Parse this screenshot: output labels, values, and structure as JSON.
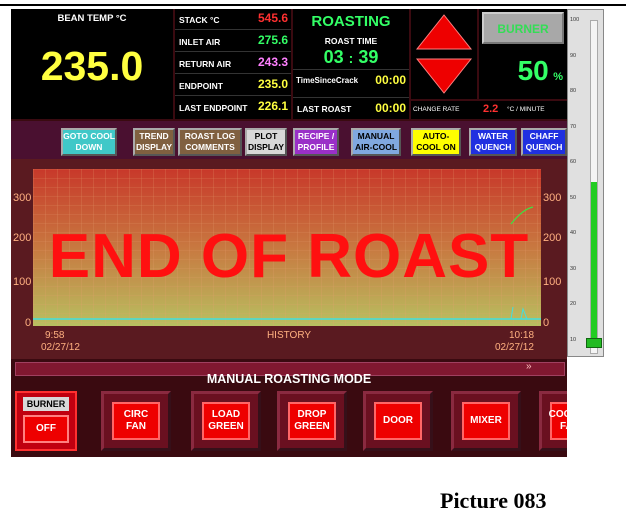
{
  "bean_temp": {
    "label": "BEAN TEMP °C",
    "value": "235.0"
  },
  "readings": [
    {
      "label": "STACK °C",
      "value": "545.6",
      "color": "#ff3030"
    },
    {
      "label": "INLET AIR",
      "value": "275.6",
      "color": "#33ff66"
    },
    {
      "label": "RETURN AIR",
      "value": "243.3",
      "color": "#ff80ff"
    },
    {
      "label": "ENDPOINT",
      "value": "235.0",
      "color": "#ffff40"
    },
    {
      "label": "LAST ENDPOINT",
      "value": "226.1",
      "color": "#ffff40"
    }
  ],
  "status": "ROASTING",
  "roast_time": {
    "label": "ROAST TIME",
    "minutes": "03",
    "sep": ":",
    "seconds": "39"
  },
  "time_since_crack": {
    "label": "TimeSinceCrack",
    "value": "00:00"
  },
  "last_roast": {
    "label": "LAST ROAST",
    "value": "00:00"
  },
  "burner": {
    "label": "BURNER",
    "value": "50",
    "unit": "%"
  },
  "change_rate": {
    "label": "CHANGE RATE",
    "value": "2.2",
    "unit": "°C / MINUTE"
  },
  "toolbar": {
    "goto_cool_down": "GOTO COOL DOWN",
    "trend_display": "TREND DISPLAY",
    "roast_log_comments": "ROAST LOG COMMENTS",
    "plot_display": "PLOT DISPLAY",
    "recipe_profile": "RECIPE / PROFILE",
    "manual_air_cool": "MANUAL AIR-COOL",
    "auto_cool_on": "AUTO-COOL ON",
    "water_quench": "WATER QUENCH",
    "chaff_quench": "CHAFF QUENCH"
  },
  "plot": {
    "overlay": "END OF ROAST",
    "history": "HISTORY",
    "left_ticks": [
      "300",
      "200",
      "100",
      "0"
    ],
    "right_ticks": [
      "300",
      "200",
      "100",
      "0"
    ],
    "start_time": "9:58",
    "start_date": "02/27/12",
    "end_time": "10:18",
    "end_date": "02/27/12"
  },
  "mode": "MANUAL ROASTING MODE",
  "scroll_marker": "»",
  "gauge": {
    "ticks": [
      "100",
      "90",
      "80",
      "70",
      "60",
      "50",
      "40",
      "30",
      "20",
      "10"
    ],
    "level_percent": 50
  },
  "buttons": {
    "burner_label": "BURNER",
    "burner_state": "OFF",
    "circ_fan": "CIRC FAN",
    "load_green": "LOAD GREEN",
    "drop_green": "DROP GREEN",
    "door": "DOOR",
    "mixer": "MIXER",
    "cooler_fan": "COOLER FAN"
  },
  "caption": "Picture 083"
}
